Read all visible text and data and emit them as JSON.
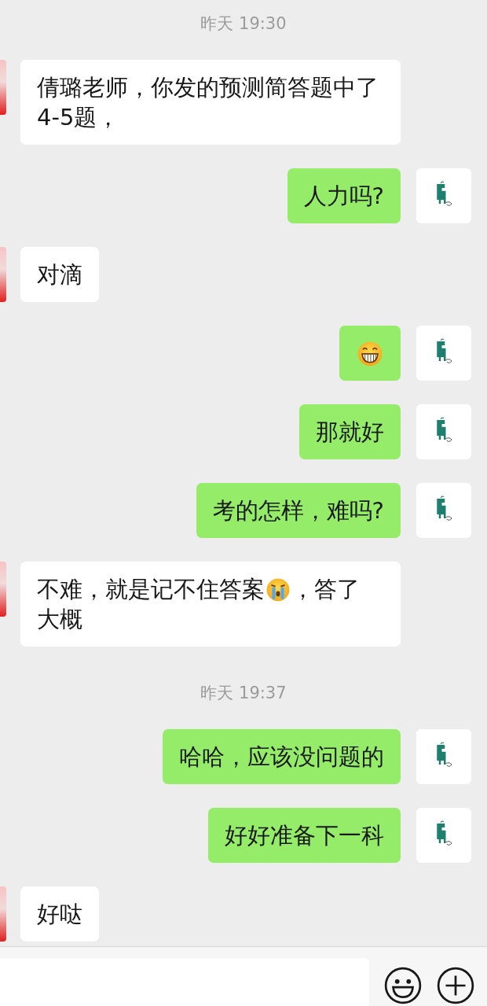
{
  "messages": [
    {
      "kind": "time",
      "text": "昨天 19:30"
    },
    {
      "kind": "text",
      "from_me": false,
      "text": "倩璐老师，你发的预测简答题中了4-5题，"
    },
    {
      "kind": "text",
      "from_me": true,
      "text": "人力吗?"
    },
    {
      "kind": "text",
      "from_me": false,
      "text": "对滴"
    },
    {
      "kind": "grin",
      "from_me": true
    },
    {
      "kind": "text",
      "from_me": true,
      "text": "那就好"
    },
    {
      "kind": "text",
      "from_me": true,
      "text": "考的怎样，难吗?"
    },
    {
      "kind": "mixed",
      "from_me": false,
      "parts": [
        {
          "kind": "text",
          "text": "不难，就是记不住答案"
        },
        {
          "kind": "cry"
        },
        {
          "kind": "text",
          "text": "，答了"
        },
        {
          "kind": "text",
          "text": "大概"
        }
      ]
    },
    {
      "kind": "time",
      "text": "昨天 19:37"
    },
    {
      "kind": "text",
      "from_me": true,
      "text": "哈哈，应该没问题的"
    },
    {
      "kind": "text",
      "from_me": true,
      "text": "好好准备下一科"
    },
    {
      "kind": "text",
      "from_me": false,
      "text": "好哒"
    }
  ]
}
